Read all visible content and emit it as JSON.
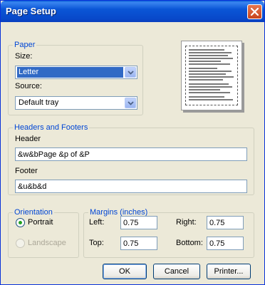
{
  "window": {
    "title": "Page Setup"
  },
  "paper": {
    "legend": "Paper",
    "size_label": "Size:",
    "size_value": "Letter",
    "source_label": "Source:",
    "source_value": "Default tray"
  },
  "headers_footers": {
    "legend": "Headers and Footers",
    "header_label": "Header",
    "header_value": "&w&bPage &p of &P",
    "footer_label": "Footer",
    "footer_value": "&u&b&d"
  },
  "orientation": {
    "legend": "Orientation",
    "portrait_label": "Portrait",
    "landscape_label": "Landscape",
    "selected": "Portrait"
  },
  "margins": {
    "legend": "Margins (inches)",
    "left_label": "Left:",
    "left_value": "0.75",
    "right_label": "Right:",
    "right_value": "0.75",
    "top_label": "Top:",
    "top_value": "0.75",
    "bottom_label": "Bottom:",
    "bottom_value": "0.75"
  },
  "buttons": {
    "ok": "OK",
    "cancel": "Cancel",
    "printer": "Printer..."
  },
  "colors": {
    "titlebar": "#0a56d6",
    "legend_text": "#0046d5",
    "selection": "#316ac5",
    "dialog_bg": "#ece9d8"
  },
  "icons": [
    "close-icon",
    "chevron-down-icon",
    "page-preview"
  ]
}
